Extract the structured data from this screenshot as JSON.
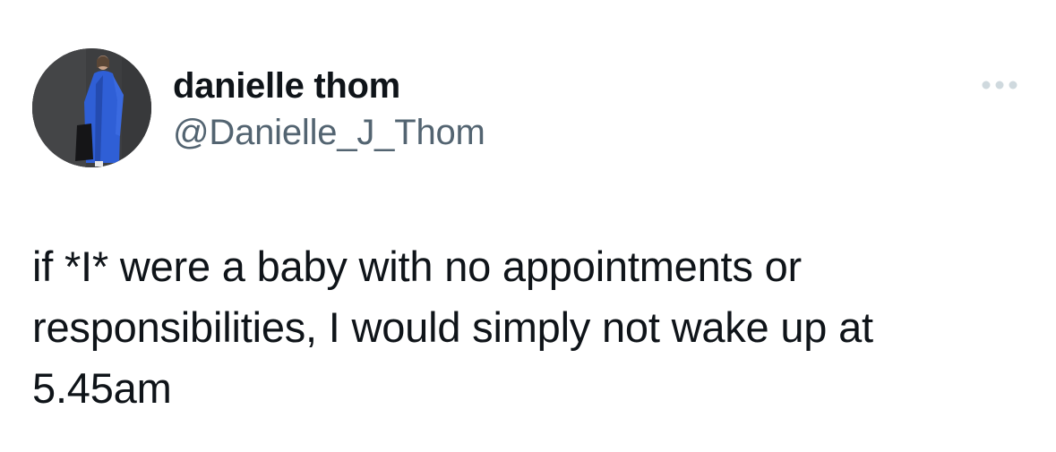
{
  "author": {
    "display_name": "danielle thom",
    "handle": "@Danielle_J_Thom",
    "avatar_icon": "profile-photo"
  },
  "menu": {
    "icon": "more-horizontal-icon"
  },
  "tweet": {
    "lines": [
      "if *I* were a baby with no appointments or",
      "responsibilities, I would simply not wake up at",
      "5.45am"
    ]
  },
  "colors": {
    "text_primary": "#0f1419",
    "text_secondary": "#536471",
    "icon_muted": "#cfd9de",
    "coat_blue": "#2f5fd6"
  }
}
